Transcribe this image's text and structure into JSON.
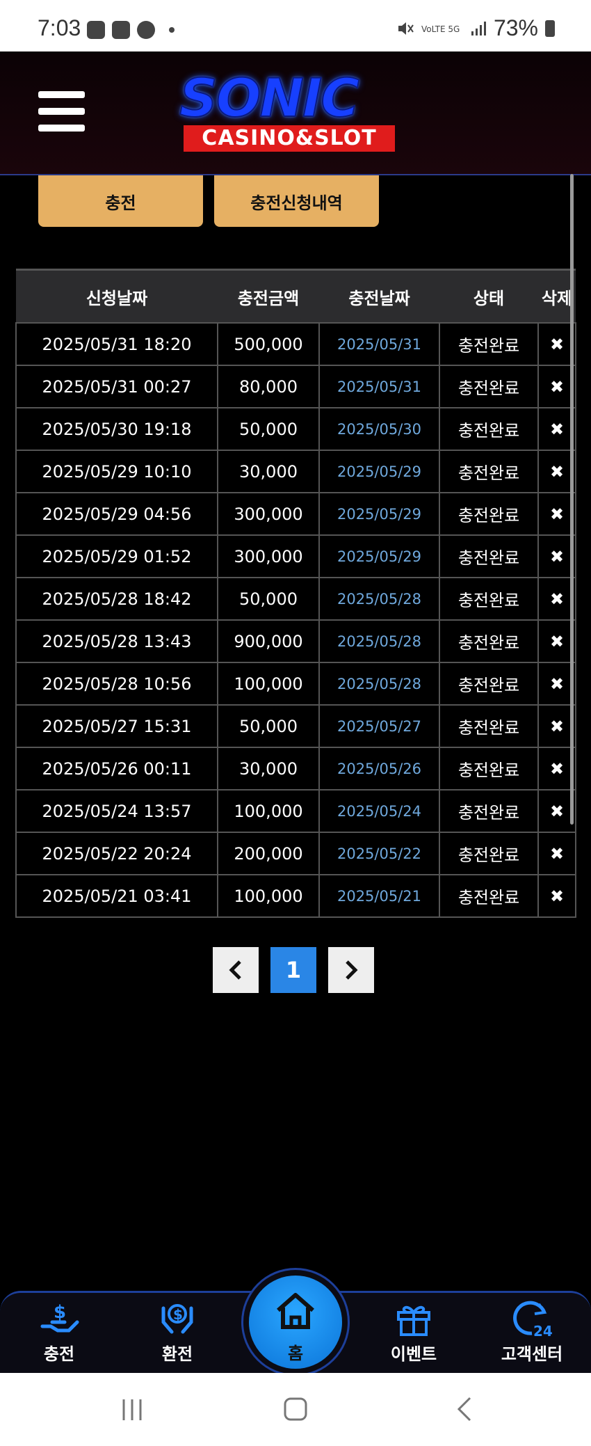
{
  "status_bar": {
    "time": "7:03",
    "battery": "73%"
  },
  "header": {
    "logo_sonic": "SONIC",
    "logo_sub": "CASINO&SLOT"
  },
  "tabs": [
    {
      "label": "충전"
    },
    {
      "label": "충전신청내역"
    }
  ],
  "table": {
    "headers": [
      "신청날짜",
      "충전금액",
      "충전날짜",
      "상태",
      "삭제"
    ],
    "rows": [
      [
        "2025/05/31 18:20",
        "500,000",
        "2025/05/31",
        "충전완료",
        "✖"
      ],
      [
        "2025/05/31 00:27",
        "80,000",
        "2025/05/31",
        "충전완료",
        "✖"
      ],
      [
        "2025/05/30 19:18",
        "50,000",
        "2025/05/30",
        "충전완료",
        "✖"
      ],
      [
        "2025/05/29 10:10",
        "30,000",
        "2025/05/29",
        "충전완료",
        "✖"
      ],
      [
        "2025/05/29 04:56",
        "300,000",
        "2025/05/29",
        "충전완료",
        "✖"
      ],
      [
        "2025/05/29 01:52",
        "300,000",
        "2025/05/29",
        "충전완료",
        "✖"
      ],
      [
        "2025/05/28 18:42",
        "50,000",
        "2025/05/28",
        "충전완료",
        "✖"
      ],
      [
        "2025/05/28 13:43",
        "900,000",
        "2025/05/28",
        "충전완료",
        "✖"
      ],
      [
        "2025/05/28 10:56",
        "100,000",
        "2025/05/28",
        "충전완료",
        "✖"
      ],
      [
        "2025/05/27 15:31",
        "50,000",
        "2025/05/27",
        "충전완료",
        "✖"
      ],
      [
        "2025/05/26 00:11",
        "30,000",
        "2025/05/26",
        "충전완료",
        "✖"
      ],
      [
        "2025/05/24 13:57",
        "100,000",
        "2025/05/24",
        "충전완료",
        "✖"
      ],
      [
        "2025/05/22 20:24",
        "200,000",
        "2025/05/22",
        "충전완료",
        "✖"
      ],
      [
        "2025/05/21 03:41",
        "100,000",
        "2025/05/21",
        "충전완료",
        "✖"
      ]
    ]
  },
  "pagination": {
    "prev": "‹",
    "current": "1",
    "next": "›"
  },
  "bottom_nav": {
    "deposit": "충전",
    "withdraw": "환전",
    "home": "홈",
    "event": "이벤트",
    "support": "고객센터"
  },
  "colors": {
    "accent": "#2a86e6",
    "tab": "#e6b063",
    "date_link": "#6fa8dc"
  }
}
